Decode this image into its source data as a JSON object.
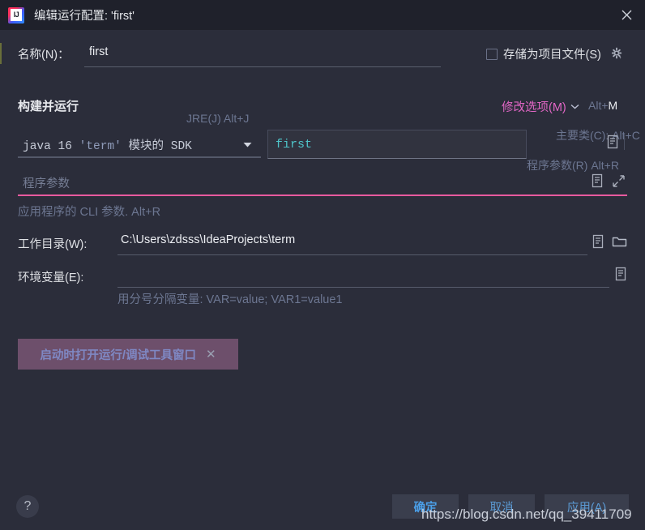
{
  "window": {
    "title": "编辑运行配置: 'first'",
    "logo_icon": "intellij-idea-logo",
    "close_icon": "close-icon"
  },
  "name_row": {
    "label": "名称(N)：",
    "value": "first",
    "placeholder": ""
  },
  "store_as_project": {
    "label": "存储为项目文件(S)",
    "checked": false,
    "gear_icon": "gear-icon"
  },
  "build_and_run": {
    "heading": "构建并运行",
    "modify_options": {
      "label": "修改选项(M)",
      "shortcut": "Alt+M",
      "shortcut_mnemonic": "M",
      "chevron_icon": "chevron-down-icon",
      "color": "#e166c5"
    },
    "jre": {
      "hint": "JRE(J) Alt+J",
      "hint_mnemonic": "J",
      "value_prefix": "java 16 ",
      "value_module": "'term'",
      "value_suffix": " 模块的 SDK",
      "dropdown_icon": "dropdown-triangle-icon"
    },
    "main_class": {
      "hint": "主要类(C): Alt+C",
      "hint_mnemonic": "C",
      "value": "first",
      "browse_icon": "macro-list-icon"
    },
    "program_arguments": {
      "hint": "程序参数(R) Alt+R",
      "hint_mnemonic": "R",
      "placeholder": "程序参数",
      "value": "",
      "help_text": "应用程序的 CLI 参数. Alt+R",
      "macro_icon": "macro-list-icon",
      "expand_icon": "expand-icon",
      "focus_underline_color": "#e85a9e"
    }
  },
  "working_directory": {
    "label": "工作目录(W):",
    "value": "C:\\Users\\zdsss\\IdeaProjects\\term",
    "macro_icon": "macro-list-icon",
    "browse_icon": "folder-icon"
  },
  "environment_variables": {
    "label": "环境变量(E):",
    "value": "",
    "help_text": "用分号分隔变量: VAR=value; VAR1=value1",
    "macro_icon": "macro-list-icon"
  },
  "option_chips": [
    {
      "label": "启动时打开运行/调试工具窗口",
      "close_icon": "close-icon",
      "background": "#6d4f6b"
    }
  ],
  "footer": {
    "help_label": "?",
    "help_icon": "question-mark-icon",
    "buttons": [
      {
        "label": "确定",
        "primary": true
      },
      {
        "label": "取消",
        "primary": false
      },
      {
        "label": "应用(A)",
        "primary": false
      }
    ]
  },
  "watermark": {
    "text": "https://blog.csdn.net/qq_39411709"
  }
}
